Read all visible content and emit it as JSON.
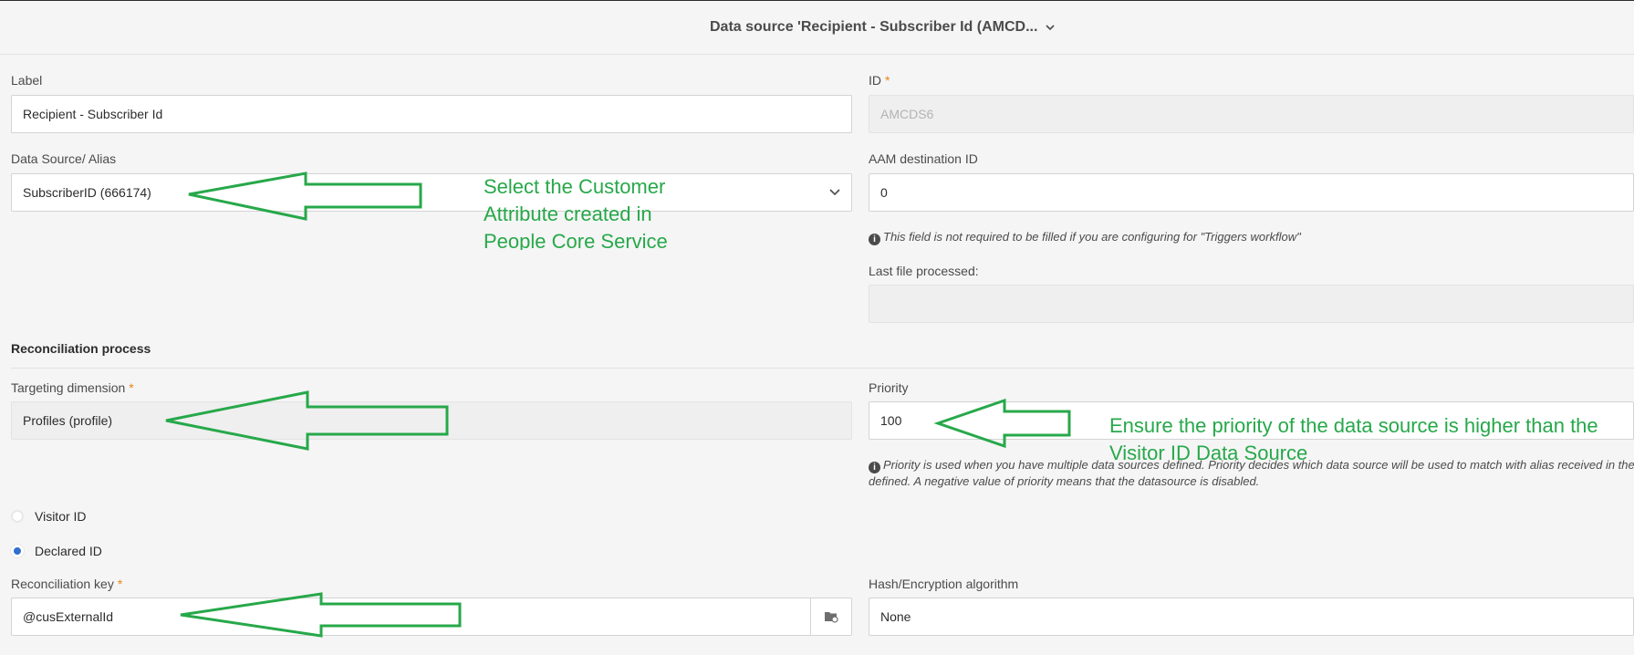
{
  "header": {
    "title": "Data source 'Recipient - Subscriber Id (AMCD..."
  },
  "form": {
    "label": {
      "label": "Label",
      "value": "Recipient - Subscriber Id"
    },
    "id": {
      "label": "ID",
      "required": "*",
      "value": "AMCDS6"
    },
    "data_source_alias": {
      "label": "Data Source/ Alias",
      "value": "SubscriberID (666174)"
    },
    "aam_destination_id": {
      "label": "AAM destination ID",
      "value": "0",
      "note": "This field is not required to be filled if you are configuring for \"Triggers workflow\""
    },
    "last_file_processed": {
      "label": "Last file processed:",
      "value": ""
    },
    "reconciliation_section": "Reconciliation process",
    "targeting_dimension": {
      "label": "Targeting dimension",
      "required": "*",
      "value": "Profiles (profile)"
    },
    "priority": {
      "label": "Priority",
      "value": "100",
      "note_line1": "Priority is used when you have multiple data sources defined. Priority decides which data source will be used to match with alias received in the or",
      "note_line2": "defined. A negative value of priority means that the datasource is disabled."
    },
    "id_type": {
      "options": [
        {
          "label": "Visitor ID",
          "selected": false
        },
        {
          "label": "Declared ID",
          "selected": true
        }
      ]
    },
    "reconciliation_key": {
      "label": "Reconciliation key",
      "required": "*",
      "value": "@cusExternalId"
    },
    "hash_algorithm": {
      "label": "Hash/Encryption algorithm",
      "value": "None"
    }
  },
  "annotations": {
    "customer_attribute": [
      "Select the Customer",
      "Attribute created in",
      "People Core Service"
    ],
    "priority": [
      "Ensure the priority of the data source is higher than the",
      "Visitor ID Data Source"
    ]
  },
  "colors": {
    "arrow": "#27a84a",
    "accent": "#2f6fd0",
    "required": "#e68619"
  }
}
